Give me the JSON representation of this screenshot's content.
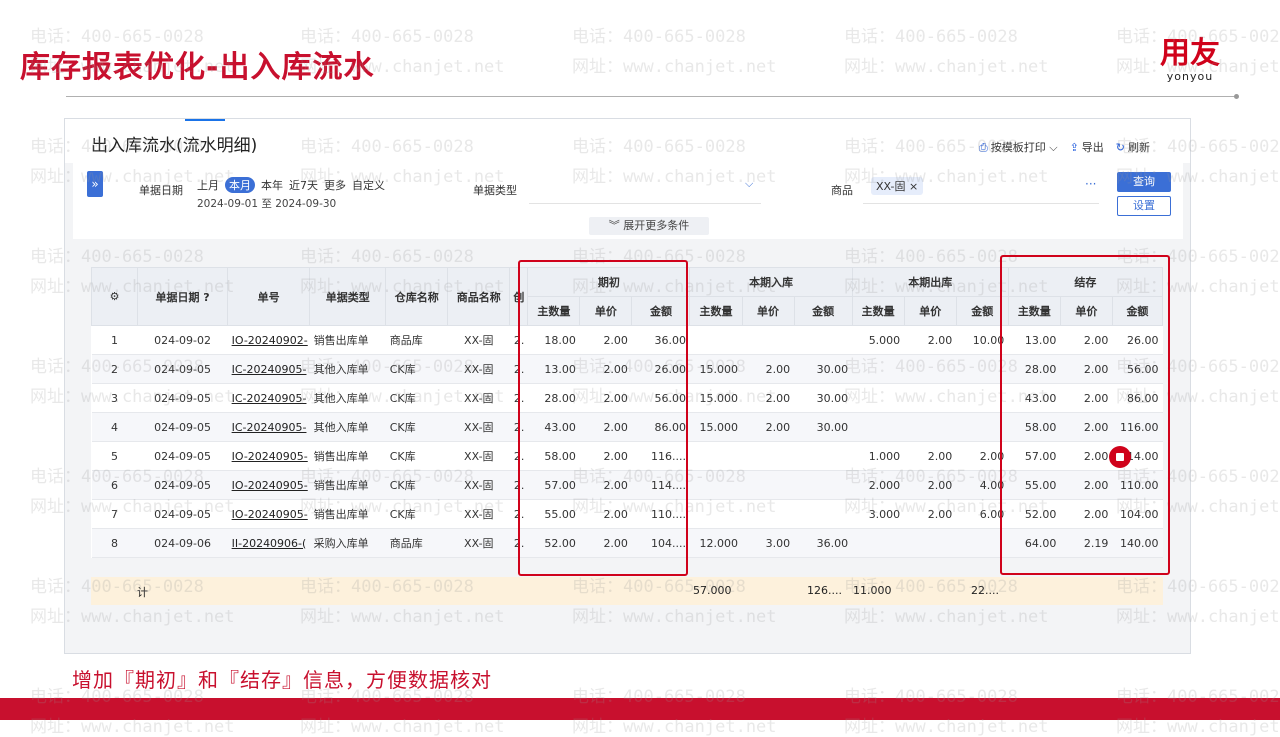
{
  "slide": {
    "title": "库存报表优化-出入库流水",
    "logo_cn": "用友",
    "logo_en": "yonyou",
    "footnote": "增加『期初』和『结存』信息，方便数据核对",
    "accent_color": "#c8102e"
  },
  "watermark": {
    "phone": "电话：400-665-0028",
    "site": "网址：www.chanjet.net"
  },
  "app": {
    "page_title": "出入库流水(流水明细)",
    "actions": [
      {
        "icon": "printer-icon",
        "label": "按模板打印"
      },
      {
        "icon": "export-icon",
        "label": "导出"
      },
      {
        "icon": "refresh-icon",
        "label": "刷新"
      }
    ],
    "filter": {
      "date_label": "单据日期",
      "periods": [
        "上月",
        "本月",
        "本年",
        "近7天",
        "更多",
        "自定义"
      ],
      "active_period": "本月",
      "date_range": "2024-09-01 至 2024-09-30",
      "doc_type_label": "单据类型",
      "product_label": "商品",
      "product_chip": "XX-固",
      "more": "···",
      "query_button": "查询",
      "settings_button": "设置",
      "expand": "展开更多条件"
    }
  },
  "table": {
    "headers": {
      "date": "单据日期",
      "no": "单号",
      "doc_type": "单据类型",
      "warehouse": "仓库名称",
      "product": "商品名称",
      "created": "创",
      "opening": "期初",
      "inbound": "本期入库",
      "outbound": "本期出库",
      "balance": "结存",
      "qty": "主数量",
      "price": "单价",
      "amount": "金额"
    },
    "rows": [
      {
        "idx": "1",
        "date": "024-09-02",
        "no": "IO-20240902-",
        "type": "销售出库单",
        "wh": "商品库",
        "prod": "XX-固",
        "c": "2.",
        "oq": "18.00",
        "op": "2.00",
        "oa": "36.00",
        "iq": "",
        "ip": "",
        "ia": "",
        "xq": "5.000",
        "xp": "2.00",
        "xa": "10.00",
        "bq": "13.00",
        "bp": "2.00",
        "ba": "26.00"
      },
      {
        "idx": "2",
        "date": "024-09-05",
        "no": "IC-20240905-",
        "type": "其他入库单",
        "wh": "CK库",
        "prod": "XX-固",
        "c": "2.",
        "oq": "13.00",
        "op": "2.00",
        "oa": "26.00",
        "iq": "15.000",
        "ip": "2.00",
        "ia": "30.00",
        "xq": "",
        "xp": "",
        "xa": "",
        "bq": "28.00",
        "bp": "2.00",
        "ba": "56.00"
      },
      {
        "idx": "3",
        "date": "024-09-05",
        "no": "IC-20240905-",
        "type": "其他入库单",
        "wh": "CK库",
        "prod": "XX-固",
        "c": "2.",
        "oq": "28.00",
        "op": "2.00",
        "oa": "56.00",
        "iq": "15.000",
        "ip": "2.00",
        "ia": "30.00",
        "xq": "",
        "xp": "",
        "xa": "",
        "bq": "43.00",
        "bp": "2.00",
        "ba": "86.00"
      },
      {
        "idx": "4",
        "date": "024-09-05",
        "no": "IC-20240905-",
        "type": "其他入库单",
        "wh": "CK库",
        "prod": "XX-固",
        "c": "2.",
        "oq": "43.00",
        "op": "2.00",
        "oa": "86.00",
        "iq": "15.000",
        "ip": "2.00",
        "ia": "30.00",
        "xq": "",
        "xp": "",
        "xa": "",
        "bq": "58.00",
        "bp": "2.00",
        "ba": "116.00"
      },
      {
        "idx": "5",
        "date": "024-09-05",
        "no": "IO-20240905-",
        "type": "销售出库单",
        "wh": "CK库",
        "prod": "XX-固",
        "c": "2.",
        "oq": "58.00",
        "op": "2.00",
        "oa": "116....",
        "iq": "",
        "ip": "",
        "ia": "",
        "xq": "1.000",
        "xp": "2.00",
        "xa": "2.00",
        "bq": "57.00",
        "bp": "2.00",
        "ba": "114.00"
      },
      {
        "idx": "6",
        "date": "024-09-05",
        "no": "IO-20240905-",
        "type": "销售出库单",
        "wh": "CK库",
        "prod": "XX-固",
        "c": "2.",
        "oq": "57.00",
        "op": "2.00",
        "oa": "114....",
        "iq": "",
        "ip": "",
        "ia": "",
        "xq": "2.000",
        "xp": "2.00",
        "xa": "4.00",
        "bq": "55.00",
        "bp": "2.00",
        "ba": "110.00"
      },
      {
        "idx": "7",
        "date": "024-09-05",
        "no": "IO-20240905-",
        "type": "销售出库单",
        "wh": "CK库",
        "prod": "XX-固",
        "c": "2.",
        "oq": "55.00",
        "op": "2.00",
        "oa": "110....",
        "iq": "",
        "ip": "",
        "ia": "",
        "xq": "3.000",
        "xp": "2.00",
        "xa": "6.00",
        "bq": "52.00",
        "bp": "2.00",
        "ba": "104.00"
      },
      {
        "idx": "8",
        "date": "024-09-06",
        "no": "II-20240906-(",
        "type": "采购入库单",
        "wh": "商品库",
        "prod": "XX-固",
        "c": "2.",
        "oq": "52.00",
        "op": "2.00",
        "oa": "104....",
        "iq": "12.000",
        "ip": "3.00",
        "ia": "36.00",
        "xq": "",
        "xp": "",
        "xa": "",
        "bq": "64.00",
        "bp": "2.19",
        "ba": "140.00"
      }
    ],
    "total": {
      "label": "计",
      "in_qty": "57.000",
      "in_amount": "126....",
      "out_qty": "11.000",
      "out_amount": "22...."
    }
  }
}
